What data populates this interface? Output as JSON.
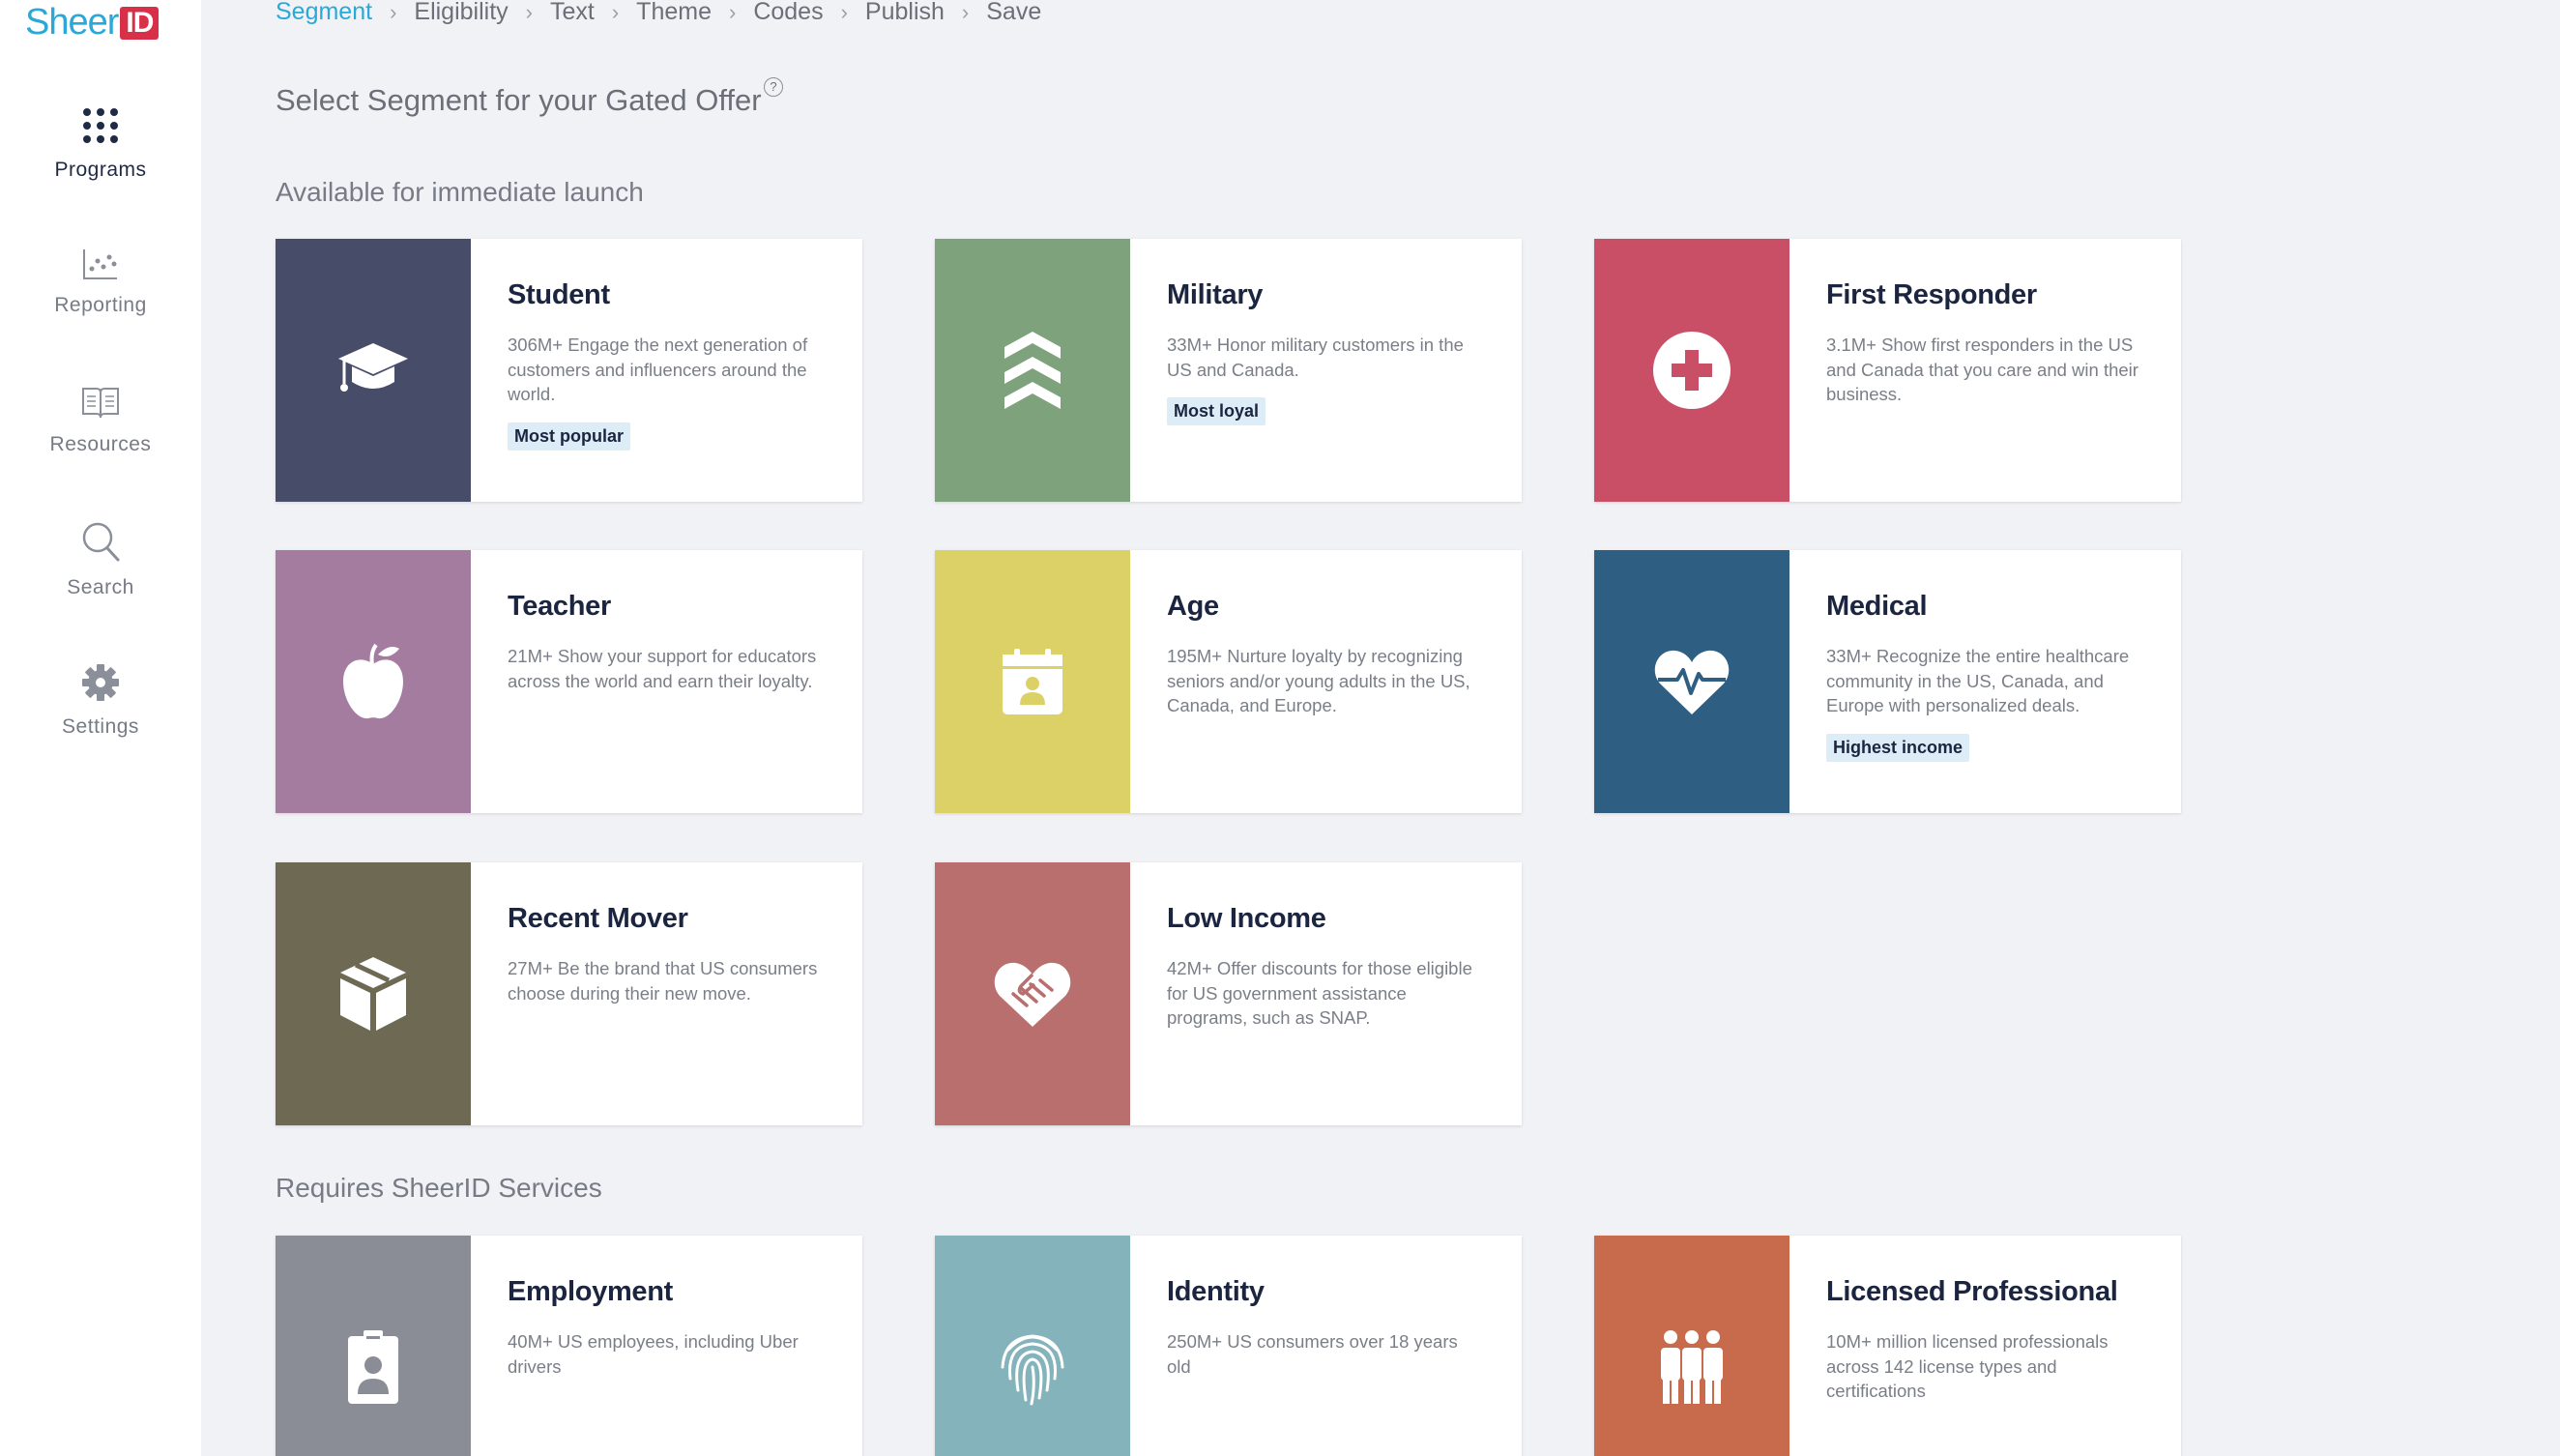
{
  "app": {
    "logo_text": "Sheer",
    "logo_mark": "ID"
  },
  "sidebar": {
    "items": [
      {
        "label": "Programs",
        "icon": "dots-grid-icon"
      },
      {
        "label": "Reporting",
        "icon": "scatter-chart-icon"
      },
      {
        "label": "Resources",
        "icon": "book-icon"
      },
      {
        "label": "Search",
        "icon": "search-icon"
      },
      {
        "label": "Settings",
        "icon": "gear-icon"
      }
    ]
  },
  "breadcrumb": [
    "Segment",
    "Eligibility",
    "Text",
    "Theme",
    "Codes",
    "Publish",
    "Save"
  ],
  "page": {
    "title": "Select Segment for your Gated Offer",
    "help": "?",
    "section_available": "Available for immediate launch",
    "section_services": "Requires SheerID Services"
  },
  "cards": [
    {
      "title": "Student",
      "desc": "306M+ Engage the next generation of customers and influencers around the world.",
      "badge": "Most popular",
      "color": "#474d68",
      "icon": "graduation-cap-icon"
    },
    {
      "title": "Military",
      "desc": "33M+ Honor military customers in the US and Canada.",
      "badge": "Most loyal",
      "color": "#7da27c",
      "icon": "chevrons-up-icon"
    },
    {
      "title": "First Responder",
      "desc": "3.1M+ Show first responders in the US and Canada that you care and win their business.",
      "badge": "",
      "color": "#c84f66",
      "icon": "medical-cross-icon"
    },
    {
      "title": "Teacher",
      "desc": "21M+ Show your support for educators across the world and earn their loyalty.",
      "badge": "",
      "color": "#a37ca0",
      "icon": "apple-icon"
    },
    {
      "title": "Age",
      "desc": "195M+ Nurture loyalty by recognizing seniors and/or young adults in the US, Canada, and Europe.",
      "badge": "",
      "color": "#dbd166",
      "icon": "calendar-person-icon"
    },
    {
      "title": "Medical",
      "desc": "33M+ Recognize the entire healthcare community in the US, Canada, and Europe with personalized deals.",
      "badge": "Highest income",
      "color": "#2e5e82",
      "icon": "heartbeat-icon"
    },
    {
      "title": "Recent Mover",
      "desc": "27M+ Be the brand that US consumers choose during their new move.",
      "badge": "",
      "color": "#6e6953",
      "icon": "box-icon"
    },
    {
      "title": "Low Income",
      "desc": "42M+ Offer discounts for those eligible for US government assistance programs, such as SNAP.",
      "badge": "",
      "color": "#b86f6e",
      "icon": "heart-handshake-icon"
    },
    {
      "title": "Employment",
      "desc": "40M+ US employees, including Uber drivers",
      "badge": "",
      "color": "#8a8c96",
      "icon": "id-badge-icon"
    },
    {
      "title": "Identity",
      "desc": "250M+ US consumers over 18 years old",
      "badge": "",
      "color": "#85b3bc",
      "icon": "fingerprint-icon"
    },
    {
      "title": "Licensed Professional",
      "desc": "10M+ million licensed professionals across 142 license types and certifications",
      "badge": "",
      "color": "#c76b4c",
      "icon": "people-group-icon"
    }
  ]
}
